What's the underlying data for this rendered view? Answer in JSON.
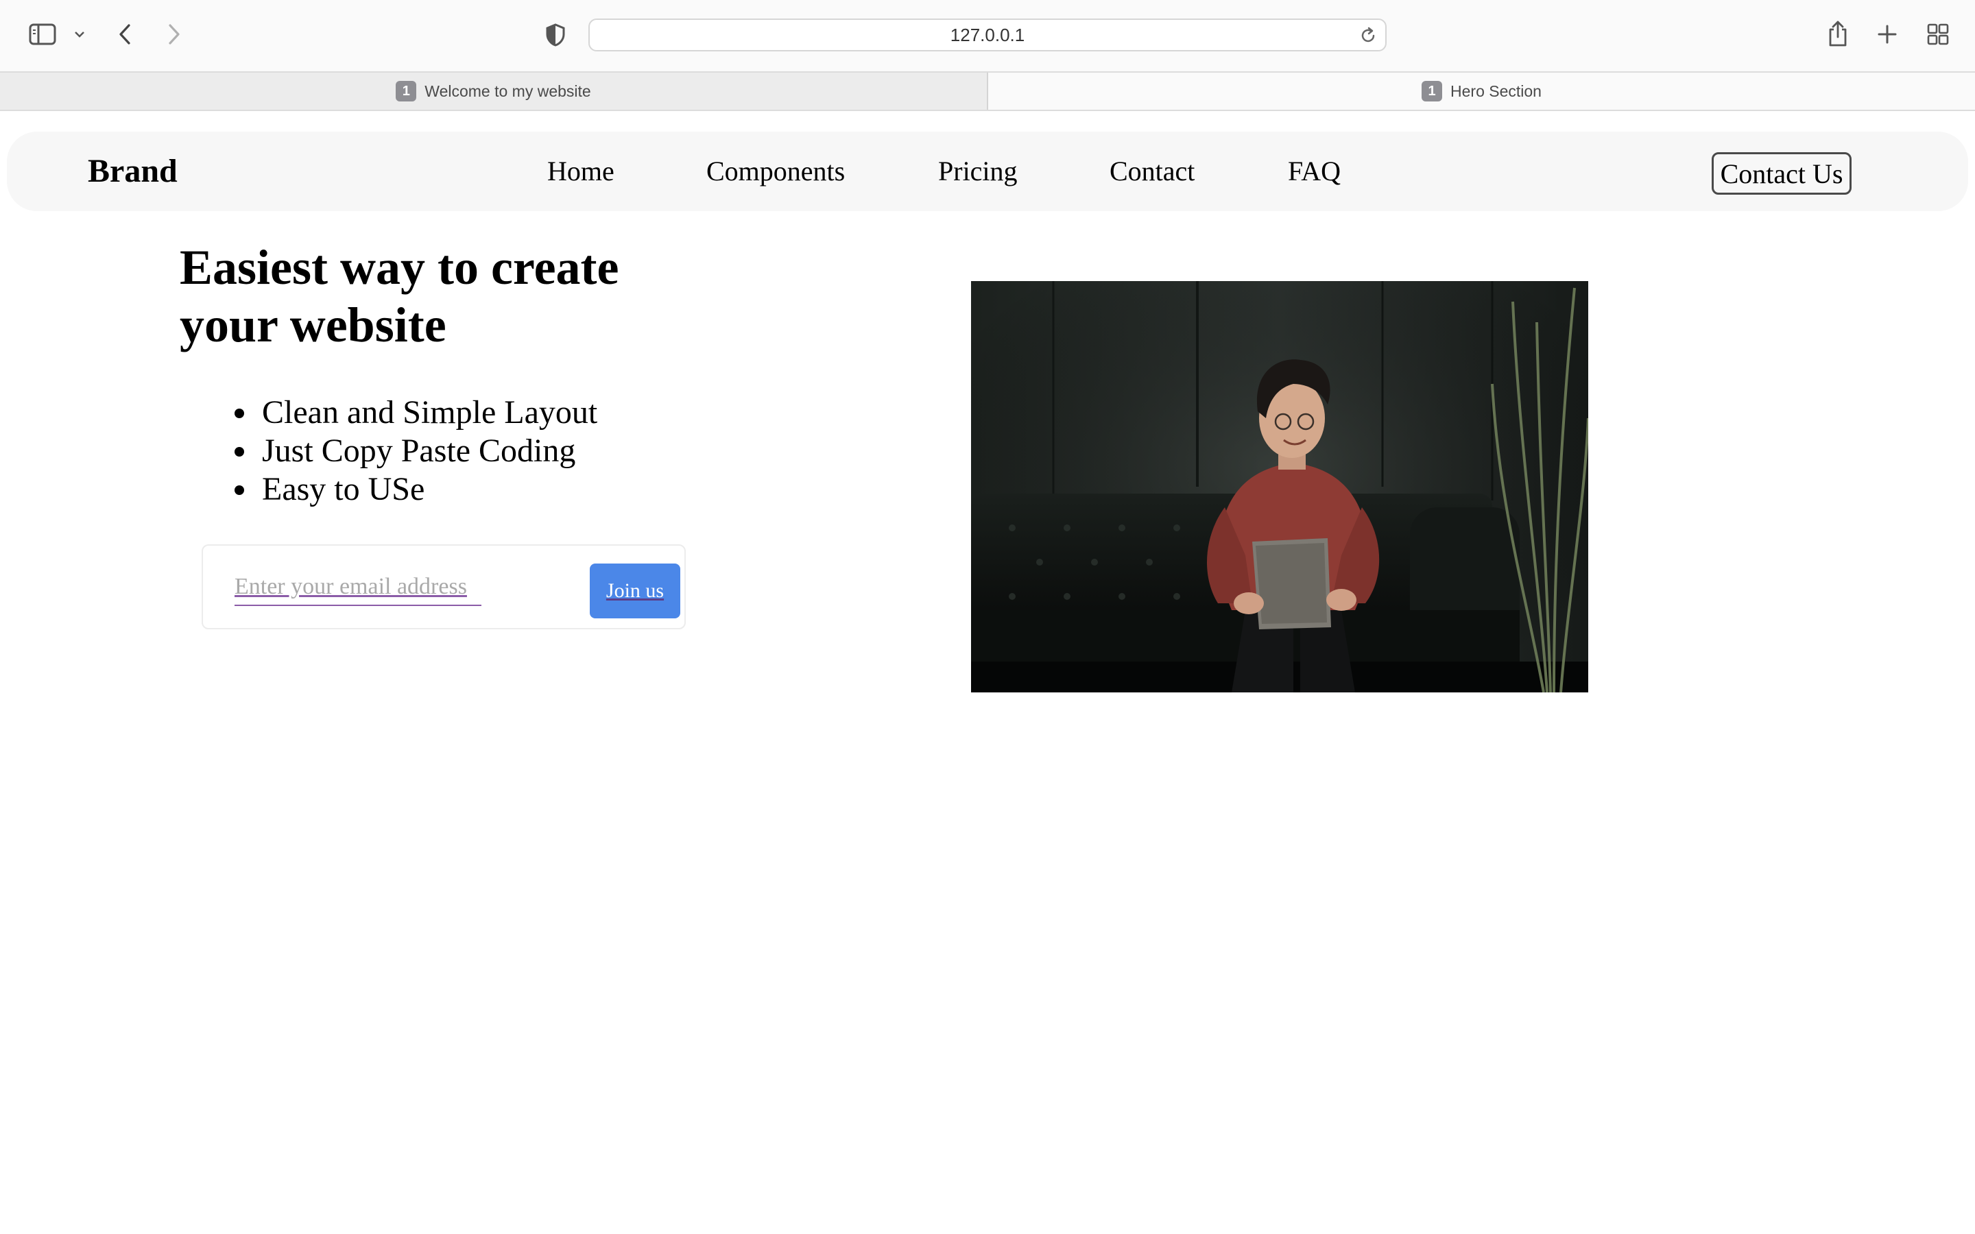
{
  "browser": {
    "url": "127.0.0.1",
    "tabs": [
      {
        "badge": "1",
        "title": "Welcome to my website",
        "active": false
      },
      {
        "badge": "1",
        "title": "Hero Section",
        "active": true
      }
    ],
    "icons": {
      "sidebar": "sidebar-icon",
      "sidebar_menu": "chevron-down-icon",
      "back": "chevron-left-icon",
      "forward": "chevron-right-icon",
      "privacy": "shield-icon",
      "reload": "reload-icon",
      "share": "share-icon",
      "new_tab": "plus-icon",
      "tab_overview": "grid-icon"
    }
  },
  "page": {
    "brand": "Brand",
    "nav": [
      "Home",
      "Components",
      "Pricing",
      "Contact",
      "FAQ"
    ],
    "nav_cta": "Contact Us",
    "hero": {
      "title": "Easiest way to create your website",
      "features": [
        "Clean and Simple Layout",
        "Just Copy Paste Coding",
        "Easy to USe"
      ],
      "email_placeholder": "Enter your email address",
      "join_label": "Join us",
      "image": "photo of a smiling person in a red sweater holding a laptop on a dark leather sofa"
    }
  },
  "colors": {
    "accent": "#4b87e8",
    "nav_background": "#f7f7f7",
    "text": "#000000"
  }
}
